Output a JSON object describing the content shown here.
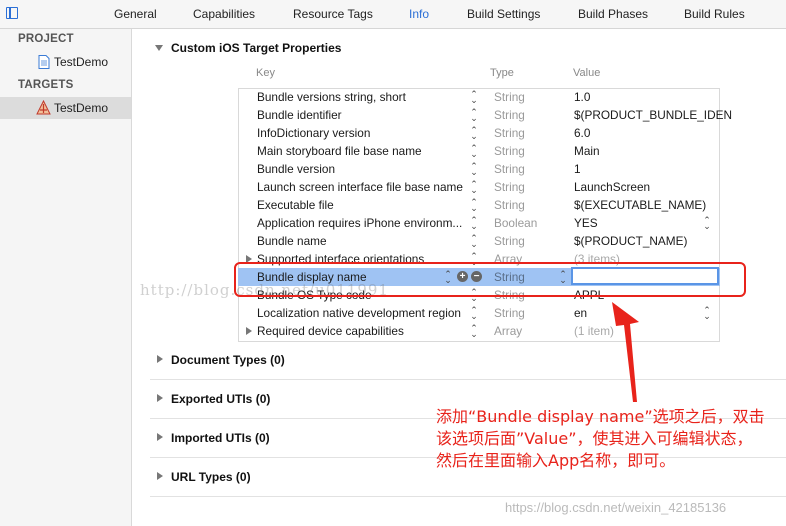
{
  "tabs": [
    {
      "label": "General",
      "active": false
    },
    {
      "label": "Capabilities",
      "active": false
    },
    {
      "label": "Resource Tags",
      "active": false
    },
    {
      "label": "Info",
      "active": true
    },
    {
      "label": "Build Settings",
      "active": false
    },
    {
      "label": "Build Phases",
      "active": false
    },
    {
      "label": "Build Rules",
      "active": false
    }
  ],
  "sidebar": {
    "project_header": "PROJECT",
    "project_item": "TestDemo",
    "targets_header": "TARGETS",
    "target_item": "TestDemo"
  },
  "main": {
    "section_title": "Custom iOS Target Properties",
    "columns": {
      "key": "Key",
      "type": "Type",
      "value": "Value"
    },
    "rows": [
      {
        "key": "Bundle versions string, short",
        "type": "String",
        "value": "1.0"
      },
      {
        "key": "Bundle identifier",
        "type": "String",
        "value": "$(PRODUCT_BUNDLE_IDEN"
      },
      {
        "key": "InfoDictionary version",
        "type": "String",
        "value": "6.0"
      },
      {
        "key": "Main storyboard file base name",
        "type": "String",
        "value": "Main"
      },
      {
        "key": "Bundle version",
        "type": "String",
        "value": "1"
      },
      {
        "key": "Launch screen interface file base name",
        "type": "String",
        "value": "LaunchScreen"
      },
      {
        "key": "Executable file",
        "type": "String",
        "value": "$(EXECUTABLE_NAME)"
      },
      {
        "key": "Application requires iPhone environm...",
        "type": "Boolean",
        "value": "YES"
      },
      {
        "key": "Bundle name",
        "type": "String",
        "value": "$(PRODUCT_NAME)"
      },
      {
        "key": "Supported interface orientations",
        "type": "Array",
        "value": "(3 items)"
      },
      {
        "key": "Bundle display name",
        "type": "String",
        "value": ""
      },
      {
        "key": "Bundle OS Type code",
        "type": "String",
        "value": "APPL"
      },
      {
        "key": "Localization native development region",
        "type": "String",
        "value": "en"
      },
      {
        "key": "Required device capabilities",
        "type": "Array",
        "value": "(1 item)"
      }
    ],
    "collapsed_sections": [
      {
        "title": "Document Types",
        "count": "(0)"
      },
      {
        "title": "Exported UTIs",
        "count": "(0)"
      },
      {
        "title": "Imported UTIs",
        "count": "(0)"
      },
      {
        "title": "URL Types",
        "count": "(0)"
      }
    ]
  },
  "annotation": {
    "line1": "添加“Bundle display name”选项之后，双击",
    "line2": "该选项后面”Value”，使其进入可编辑状态，",
    "line3": "然后在里面输入App名称，即可。"
  },
  "watermarks": {
    "overlay": "http://blog.csdn.net/u011991",
    "footer": "https://blog.csdn.net/weixin_42185136"
  },
  "colors": {
    "accent": "#2b6fd6",
    "selection": "#9fc3f3",
    "annotation_red": "#e8231b"
  }
}
